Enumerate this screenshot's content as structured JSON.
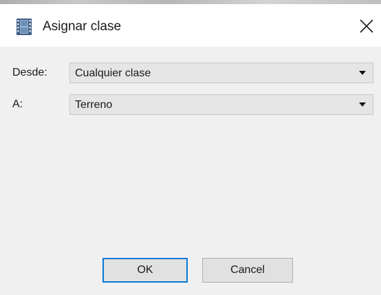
{
  "window": {
    "title": "Asignar clase",
    "icon": "film-icon",
    "close_icon": "close-icon"
  },
  "form": {
    "from_label": "Desde:",
    "from_value": "Cualquier clase",
    "to_label": "A:",
    "to_value": "Terreno"
  },
  "buttons": {
    "ok_label": "OK",
    "cancel_label": "Cancel"
  },
  "colors": {
    "focus_border": "#0078d7",
    "client_bg": "#f0f0f0"
  }
}
